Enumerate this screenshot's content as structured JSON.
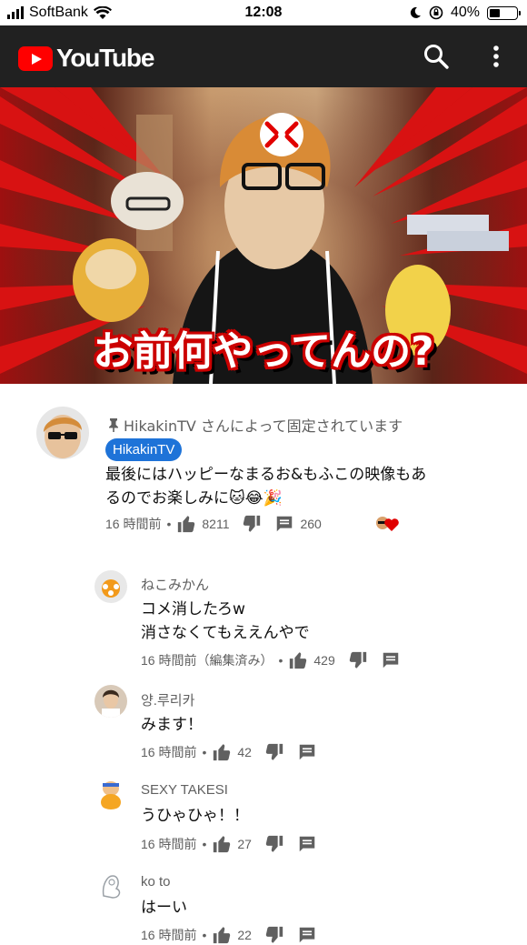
{
  "status_bar": {
    "carrier": "SoftBank",
    "time": "12:08",
    "battery": "40%",
    "battery_level": 0.4
  },
  "app": {
    "logo_text": "YouTube",
    "brand_color": "#ff0000"
  },
  "video": {
    "caption": "お前何やってんの?"
  },
  "pinned_comment": {
    "pinned_label": "HikakinTV さんによって固定されています",
    "channel_chip": "HikakinTV",
    "text_line1": "最後にはハッピーなまるお&もふこの映像もあ",
    "text_line2": "るのでお楽しみに🐱😂🎉",
    "time": "16 時間前",
    "likes": "8211",
    "replies": "260"
  },
  "replies": [
    {
      "author": "ねこみかん",
      "line1": "コメ消したろw",
      "line2": "消さなくてもええんやで",
      "time": "16 時間前（編集済み）",
      "likes": "429"
    },
    {
      "author": "양.루리카",
      "line1": "みます！",
      "line2": "",
      "time": "16 時間前",
      "likes": "42"
    },
    {
      "author": "SEXY TAKESI",
      "line1": "うひゃひゃ！！",
      "line2": "",
      "time": "16 時間前",
      "likes": "27"
    },
    {
      "author": "ko to",
      "line1": "はーい",
      "line2": "",
      "time": "16 時間前",
      "likes": "22"
    }
  ],
  "icons": {
    "like": "thumb-up-icon",
    "dislike": "thumb-down-icon",
    "reply": "comment-icon",
    "search": "search-icon",
    "more": "more-vert-icon",
    "pin": "pin-icon"
  }
}
